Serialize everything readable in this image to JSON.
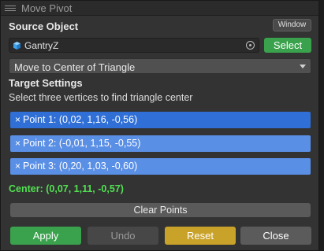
{
  "window": {
    "title": "Move Pivot"
  },
  "source": {
    "heading": "Source Object",
    "window_button": "Window",
    "object_name": "GantryZ",
    "select_button": "Select"
  },
  "mode_dropdown": {
    "selected": "Move to Center of Triangle"
  },
  "target": {
    "heading": "Target Settings",
    "help": "Select three vertices to find triangle center",
    "points": [
      {
        "label": "Point 1: (0,02, 1,16, -0,56)",
        "color": "#2f6fd6"
      },
      {
        "label": "Point 2: (-0,01, 1,15, -0,55)",
        "color": "#5a8fe6"
      },
      {
        "label": "Point 3: (0,20, 1,03, -0,60)",
        "color": "#5a8fe6"
      }
    ],
    "remove_icon": "×",
    "center": "Center: (0,07, 1,11, -0,57)"
  },
  "clear_button": "Clear Points",
  "actions": {
    "apply": "Apply",
    "undo": "Undo",
    "reset": "Reset",
    "close": "Close"
  },
  "colors": {
    "select": "#3aa24d",
    "apply": "#3aa24d",
    "undo": "#474747",
    "reset": "#c9a22a",
    "close": "#5b5b5b",
    "center_text": "#52e052"
  }
}
